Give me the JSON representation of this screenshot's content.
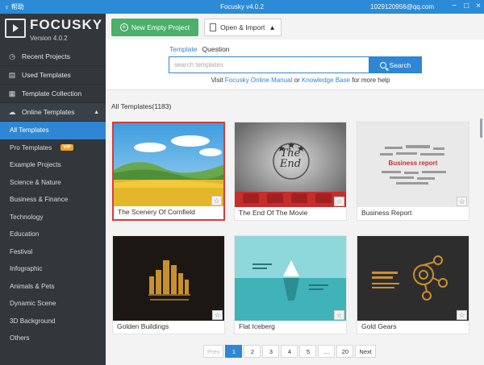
{
  "titlebar": {
    "help_label": "帮助",
    "title": "Focusky v4.0.2",
    "account": "1029120956@qq.com",
    "minimize": "−",
    "maximize": "□",
    "close": "×"
  },
  "sidebar": {
    "logo_text": "FOCUSKY",
    "version": "Version 4.0.2",
    "items": [
      {
        "label": "Recent Projects",
        "icon": "clock-icon"
      },
      {
        "label": "Used Templates",
        "icon": "layout-icon"
      },
      {
        "label": "Template Collection",
        "icon": "bookmark-icon"
      }
    ],
    "section": {
      "label": "Online Templates",
      "icon": "cloud-icon"
    },
    "sub_items": [
      {
        "label": "All Templates"
      },
      {
        "label": "Pro Templates",
        "badge": "VIP"
      },
      {
        "label": "Example Projects"
      },
      {
        "label": "Science & Nature"
      },
      {
        "label": "Business & Finance"
      },
      {
        "label": "Technology"
      },
      {
        "label": "Education"
      },
      {
        "label": "Festival"
      },
      {
        "label": "Infographic"
      },
      {
        "label": "Animals & Pets"
      },
      {
        "label": "Dynamic Scene"
      },
      {
        "label": "3D Background"
      },
      {
        "label": "Others"
      }
    ]
  },
  "toolbar": {
    "new_project": "New Empty Project",
    "open_import": "Open & Import"
  },
  "search": {
    "tab_template": "Template",
    "tab_question": "Question",
    "placeholder": "search templates",
    "button": "Search",
    "help_prefix": "Visit",
    "manual_link": "Focusky Online Manual",
    "help_or": "or",
    "kb_link": "Knowledge Base",
    "help_suffix": "for more help"
  },
  "content": {
    "count_label": "All Templates(1183)",
    "cards": [
      {
        "title": "The Scenery Of Cornfield"
      },
      {
        "title": "The End Of The Movie"
      },
      {
        "title": "Business Report"
      },
      {
        "title": "Golden Buildings"
      },
      {
        "title": "Flat Iceberg"
      },
      {
        "title": "Gold Gears"
      }
    ],
    "thumb_text": {
      "the_end_1": "The",
      "the_end_2": "End",
      "business": "Business report"
    }
  },
  "pagination": {
    "prev": "Prev",
    "pages": [
      "1",
      "2",
      "3",
      "4",
      "5",
      "...",
      "20"
    ],
    "next": "Next"
  }
}
